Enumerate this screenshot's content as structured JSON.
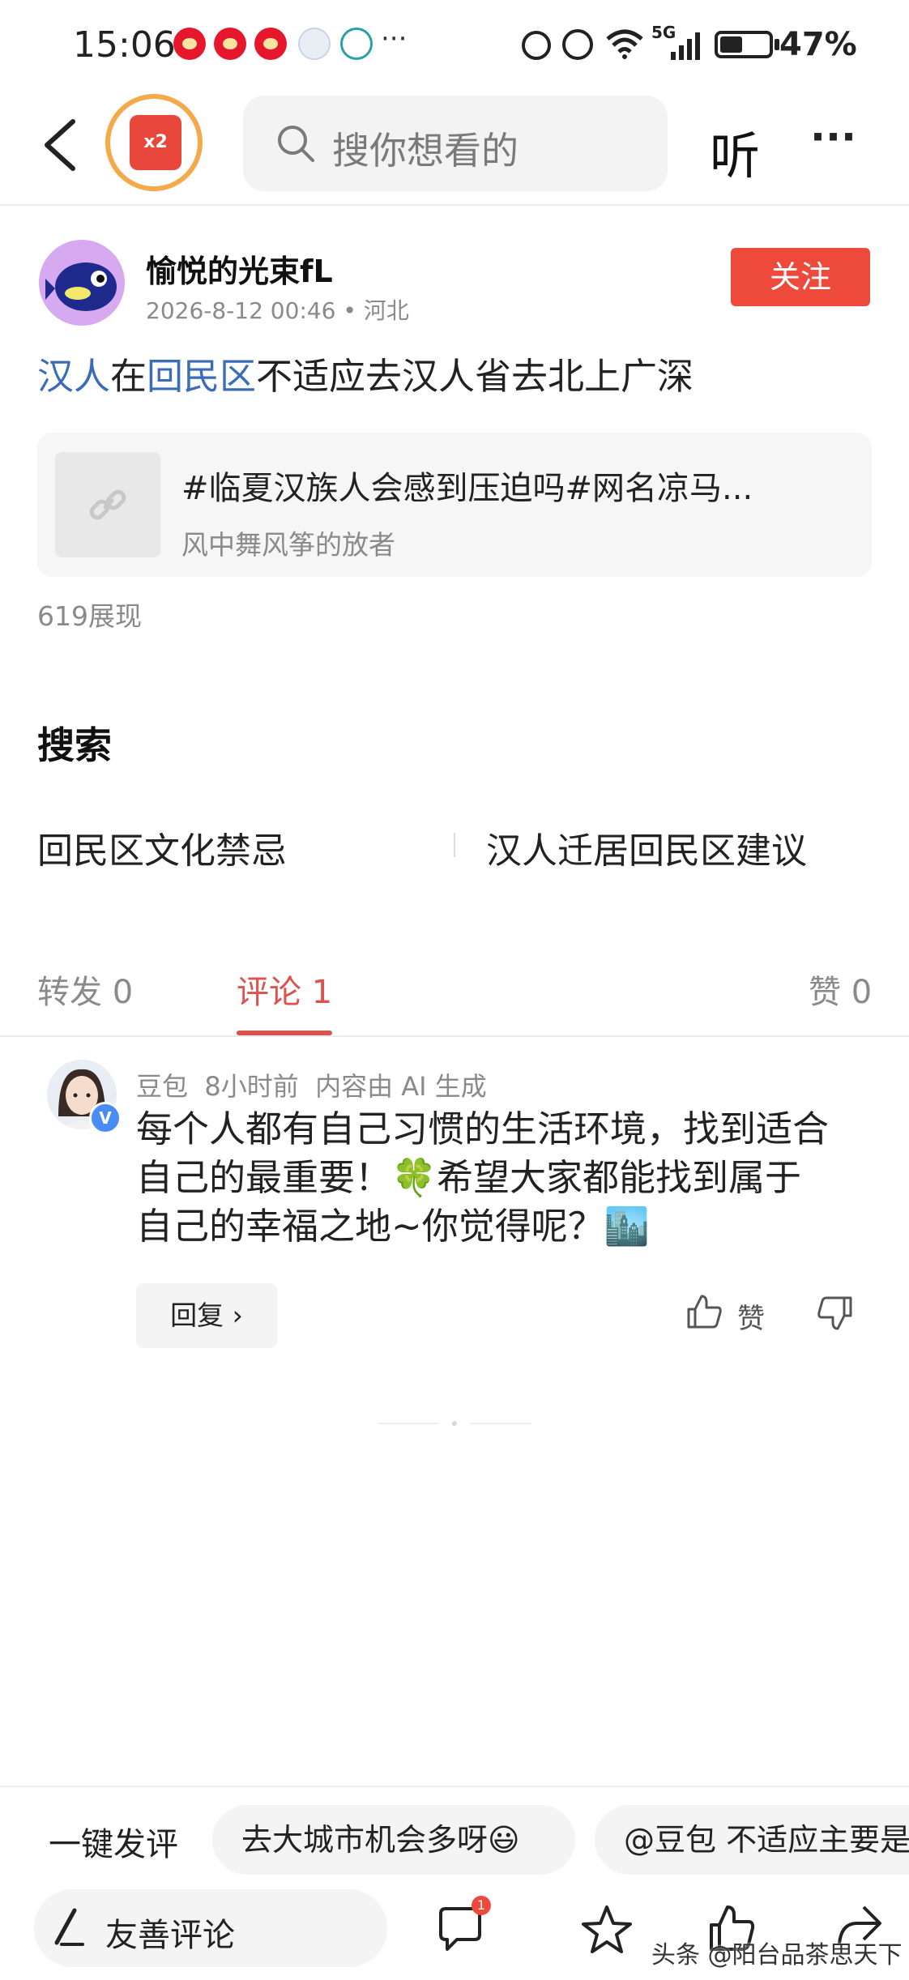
{
  "status_bar": {
    "time": "15:06",
    "network": "5G",
    "battery_percent": "47%",
    "battery_level": 0.47,
    "more": "···"
  },
  "header": {
    "search_placeholder": "搜你想看的",
    "listen_label": "听",
    "more_label": "···",
    "redpacket_badge": "x2"
  },
  "post": {
    "author": "愉悦的光束fL",
    "meta": "2026-8-12 00:46 • 河北",
    "follow_label": "关注",
    "text_parts": [
      "汉人",
      "在",
      "回民区",
      "不适应去汉人省去北上广深"
    ],
    "card": {
      "title": "#临夏汉族人会感到压迫吗#网名凉马...",
      "subtitle": "风中舞风筝的放者"
    },
    "views": "619展现"
  },
  "search_section": {
    "title": "搜索",
    "links": [
      "回民区文化禁忌",
      "汉人迁居回民区建议"
    ]
  },
  "tabs": {
    "repost": "转发 0",
    "comment": "评论 1",
    "like": "赞 0"
  },
  "comment": {
    "author": "豆包",
    "time": "8小时前",
    "ai_note": "内容由 AI 生成",
    "lines": [
      "每个人都有自己习惯的生活环境，找到适合",
      "自己的最重要！🍀希望大家都能找到属于",
      "自己的幸福之地~你觉得呢？🏙️"
    ],
    "reply_label": "回复 ›",
    "like_label": "赞",
    "verified_badge": "V"
  },
  "bottom": {
    "onekey_label": "一键发评",
    "chips": [
      "去大城市机会多呀😃",
      "@豆包 不适应主要是"
    ],
    "input_placeholder": "友善评论",
    "comment_count_badge": "1",
    "watermark": "头条 @阳台品茶思天下"
  },
  "colors": {
    "accent": "#ee4a3c",
    "link": "#3a6cb8",
    "active_tab": "#d9534f"
  }
}
